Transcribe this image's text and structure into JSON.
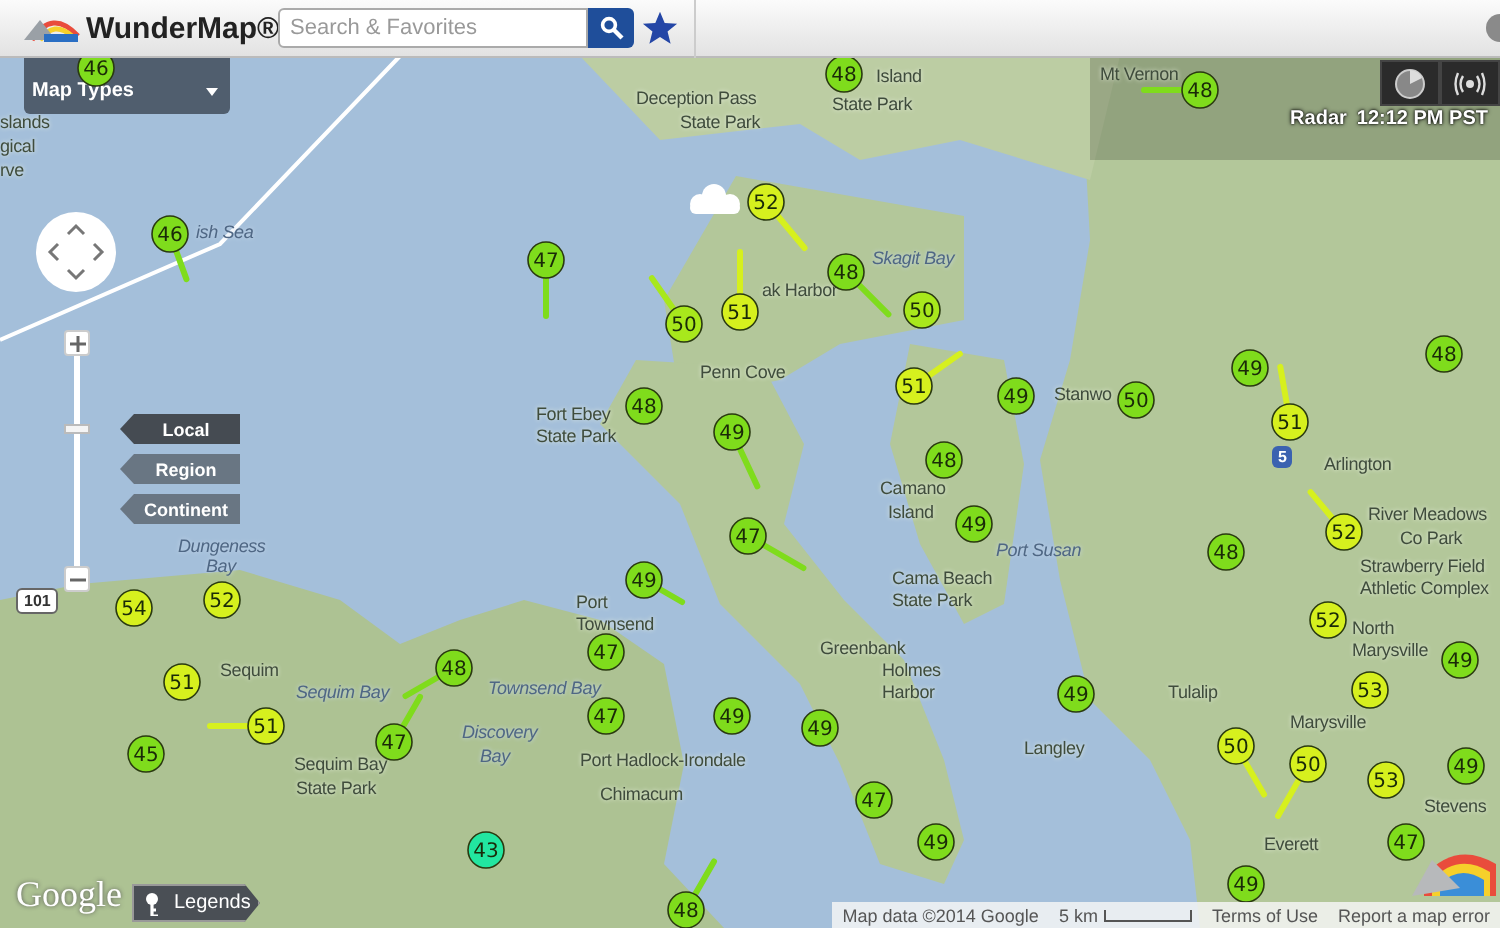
{
  "header": {
    "title": "WunderMap®",
    "search": {
      "placeholder": "Search & Favorites"
    }
  },
  "map_types": {
    "label": "Map Types"
  },
  "zoom": {
    "level": 0.65
  },
  "zoom_levels": [
    {
      "label": "Local",
      "selected": true
    },
    {
      "label": "Region",
      "selected": false
    },
    {
      "label": "Continent",
      "selected": false
    }
  ],
  "radar": {
    "label": "Radar",
    "time": "12:12 PM PST"
  },
  "stations": [
    {
      "temp": "46",
      "color": "#7fdc1c"
    },
    {
      "temp": "48",
      "color": "#7fdc1c"
    },
    {
      "temp": "48",
      "color": "#7fdc1c"
    },
    {
      "temp": "52",
      "color": "#d6f01e"
    },
    {
      "temp": "46",
      "color": "#7fdc1c"
    },
    {
      "temp": "47",
      "color": "#7fdc1c"
    },
    {
      "temp": "48",
      "color": "#7fdc1c"
    },
    {
      "temp": "50",
      "color": "#a8e81c"
    },
    {
      "temp": "51",
      "color": "#d6f01e"
    },
    {
      "temp": "50",
      "color": "#a8e81c"
    },
    {
      "temp": "49",
      "color": "#7fdc1c"
    },
    {
      "temp": "48",
      "color": "#7fdc1c"
    },
    {
      "temp": "48",
      "color": "#7fdc1c"
    },
    {
      "temp": "51",
      "color": "#d6f01e"
    },
    {
      "temp": "49",
      "color": "#7fdc1c"
    },
    {
      "temp": "50",
      "color": "#7fdc1c"
    },
    {
      "temp": "49",
      "color": "#7fdc1c"
    },
    {
      "temp": "51",
      "color": "#d6f01e"
    },
    {
      "temp": "48",
      "color": "#7fdc1c"
    },
    {
      "temp": "47",
      "color": "#7fdc1c"
    },
    {
      "temp": "49",
      "color": "#7fdc1c"
    },
    {
      "temp": "48",
      "color": "#7fdc1c"
    },
    {
      "temp": "52",
      "color": "#d6f01e"
    },
    {
      "temp": "54",
      "color": "#d6f01e"
    },
    {
      "temp": "52",
      "color": "#d6f01e"
    },
    {
      "temp": "49",
      "color": "#7fdc1c"
    },
    {
      "temp": "52",
      "color": "#d6f01e"
    },
    {
      "temp": "48",
      "color": "#7fdc1c"
    },
    {
      "temp": "47",
      "color": "#7fdc1c"
    },
    {
      "temp": "49",
      "color": "#7fdc1c"
    },
    {
      "temp": "51",
      "color": "#d6f01e"
    },
    {
      "temp": "49",
      "color": "#7fdc1c"
    },
    {
      "temp": "53",
      "color": "#d6f01e"
    },
    {
      "temp": "51",
      "color": "#d6f01e"
    },
    {
      "temp": "47",
      "color": "#7fdc1c"
    },
    {
      "temp": "49",
      "color": "#7fdc1c"
    },
    {
      "temp": "49",
      "color": "#7fdc1c"
    },
    {
      "temp": "45",
      "color": "#7fdc1c"
    },
    {
      "temp": "47",
      "color": "#7fdc1c"
    },
    {
      "temp": "50",
      "color": "#d6f01e"
    },
    {
      "temp": "50",
      "color": "#d6f01e"
    },
    {
      "temp": "49",
      "color": "#7fdc1c"
    },
    {
      "temp": "53",
      "color": "#d6f01e"
    },
    {
      "temp": "47",
      "color": "#7fdc1c"
    },
    {
      "temp": "43",
      "color": "#22e6a0"
    },
    {
      "temp": "49",
      "color": "#7fdc1c"
    },
    {
      "temp": "47",
      "color": "#7fdc1c"
    },
    {
      "temp": "49",
      "color": "#7fdc1c"
    },
    {
      "temp": "48",
      "color": "#7fdc1c"
    }
  ],
  "place_labels": [
    {
      "text": "Island",
      "kind": "land"
    },
    {
      "text": "Mt Vernon",
      "kind": "land"
    },
    {
      "text": "Deception Pass",
      "kind": "land"
    },
    {
      "text": "State Park",
      "kind": "land"
    },
    {
      "text": "slands",
      "kind": "land"
    },
    {
      "text": "State Park",
      "kind": "land"
    },
    {
      "text": "gical",
      "kind": "land"
    },
    {
      "text": "rve",
      "kind": "land"
    },
    {
      "text": "ish Sea",
      "kind": "water"
    },
    {
      "text": "Skagit Bay",
      "kind": "water"
    },
    {
      "text": "ak Harbor",
      "kind": "land"
    },
    {
      "text": "Penn Cove",
      "kind": "land"
    },
    {
      "text": "Stanwo",
      "kind": "land"
    },
    {
      "text": "Fort Ebey",
      "kind": "land"
    },
    {
      "text": "State Park",
      "kind": "land"
    },
    {
      "text": "Arlington",
      "kind": "land"
    },
    {
      "text": "Camano",
      "kind": "land"
    },
    {
      "text": "Island",
      "kind": "land"
    },
    {
      "text": "River Meadows",
      "kind": "land"
    },
    {
      "text": "Dungeness",
      "kind": "water"
    },
    {
      "text": "Port Susan",
      "kind": "water"
    },
    {
      "text": "Co Park",
      "kind": "land"
    },
    {
      "text": "Bay",
      "kind": "water"
    },
    {
      "text": "Strawberry Field",
      "kind": "land"
    },
    {
      "text": "Cama Beach",
      "kind": "land"
    },
    {
      "text": "Athletic Complex",
      "kind": "land"
    },
    {
      "text": "Port",
      "kind": "land"
    },
    {
      "text": "State Park",
      "kind": "land"
    },
    {
      "text": "Townsend",
      "kind": "land"
    },
    {
      "text": "North",
      "kind": "land"
    },
    {
      "text": "Greenbank",
      "kind": "land"
    },
    {
      "text": "Marysville",
      "kind": "land"
    },
    {
      "text": "Sequim",
      "kind": "land"
    },
    {
      "text": "Holmes",
      "kind": "land"
    },
    {
      "text": "Sequim Bay",
      "kind": "water"
    },
    {
      "text": "Townsend Bay",
      "kind": "water"
    },
    {
      "text": "Harbor",
      "kind": "land"
    },
    {
      "text": "Tulalip",
      "kind": "land"
    },
    {
      "text": "Discovery",
      "kind": "water"
    },
    {
      "text": "Marysville",
      "kind": "land"
    },
    {
      "text": "Sequim Bay",
      "kind": "land"
    },
    {
      "text": "Bay",
      "kind": "water"
    },
    {
      "text": "Port Hadlock-Irondale",
      "kind": "land"
    },
    {
      "text": "Langley",
      "kind": "land"
    },
    {
      "text": "State Park",
      "kind": "land"
    },
    {
      "text": "Chimacum",
      "kind": "land"
    },
    {
      "text": "Stevens",
      "kind": "land"
    },
    {
      "text": "Everett",
      "kind": "land"
    }
  ],
  "highway_shields": [
    "101",
    "5"
  ],
  "google_logo": "Google",
  "legends": {
    "label": "Legends"
  },
  "attribution": {
    "map_data": "Map data ©2014 Google",
    "scale": "5 km",
    "terms": "Terms of Use",
    "report": "Report a map error"
  }
}
